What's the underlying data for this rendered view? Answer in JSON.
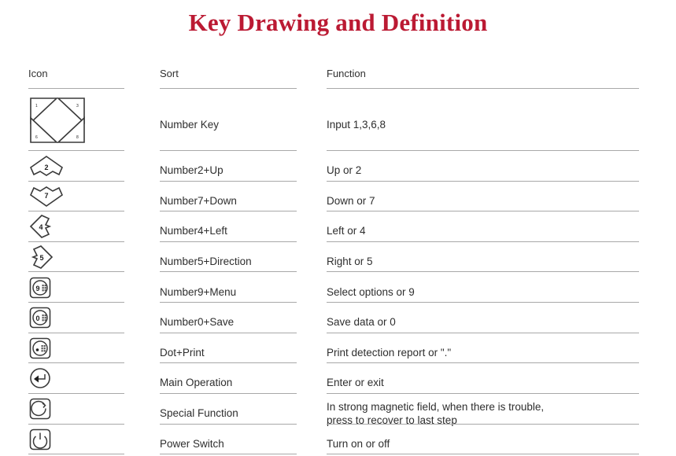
{
  "title": "Key Drawing and Definition",
  "accent_color": "#bb1a33",
  "rule_color": "#a8a8a8",
  "headers": {
    "icon": "Icon",
    "sort": "Sort",
    "function": "Function"
  },
  "rows": [
    {
      "icon_name": "four-corner-triangle-keys",
      "icon_labels": [
        "1",
        "3",
        "6",
        "8"
      ],
      "sort": "Number Key",
      "function": "Input 1,3,6,8"
    },
    {
      "icon_name": "up-arrow-key-2",
      "icon_labels": [
        "2"
      ],
      "sort": "Number2+Up",
      "function": "Up or 2"
    },
    {
      "icon_name": "down-arrow-key-7",
      "icon_labels": [
        "7"
      ],
      "sort": "Number7+Down",
      "function": "Down or 7"
    },
    {
      "icon_name": "left-arrow-key-4",
      "icon_labels": [
        "4"
      ],
      "sort": "Number4+Left",
      "function": "Left or 4"
    },
    {
      "icon_name": "right-arrow-key-5",
      "icon_labels": [
        "5"
      ],
      "sort": "Number5+Direction",
      "function": "Right or 5"
    },
    {
      "icon_name": "menu-key-9",
      "icon_labels": [
        "9"
      ],
      "sort": "Number9+Menu",
      "function": "Select options or 9"
    },
    {
      "icon_name": "save-key-0",
      "icon_labels": [
        "0"
      ],
      "sort": "Number0+Save",
      "function": "Save data or 0"
    },
    {
      "icon_name": "print-dot-key",
      "icon_labels": [
        "."
      ],
      "sort": "Dot+Print",
      "function": "Print detection report or \".\""
    },
    {
      "icon_name": "enter-key",
      "icon_labels": [],
      "sort": "Main Operation",
      "function": "Enter or exit"
    },
    {
      "icon_name": "special-function-key",
      "icon_labels": [],
      "sort": "Special Function",
      "function": "In strong magnetic field, when there is trouble,\npress to recover to last step"
    },
    {
      "icon_name": "power-switch-key",
      "icon_labels": [],
      "sort": "Power Switch",
      "function": "Turn on or off"
    }
  ]
}
